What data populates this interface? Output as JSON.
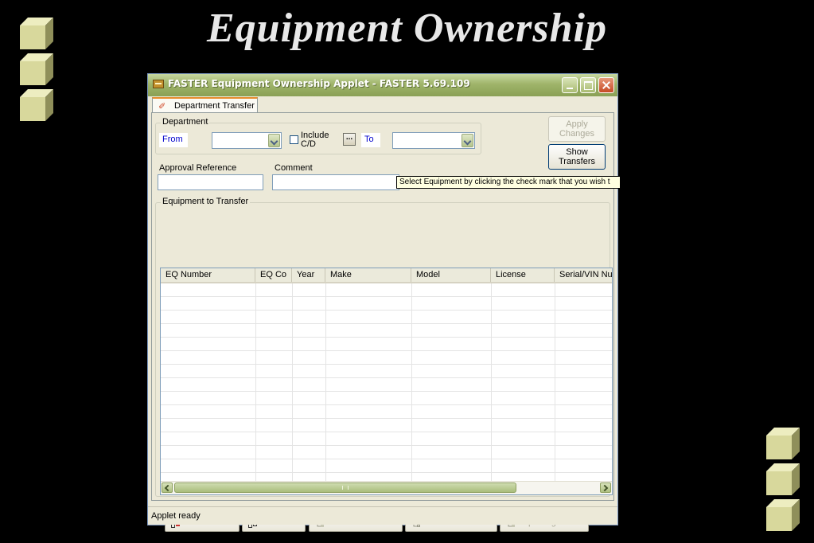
{
  "slide": {
    "title": "Equipment Ownership"
  },
  "window": {
    "title": "FASTER Equipment Ownership Applet - FASTER 5.69.109"
  },
  "tab": {
    "label": "Department Transfer"
  },
  "department": {
    "legend": "Department",
    "from_label": "From",
    "from_value": "",
    "include_cd_label": "Include C/D",
    "include_cd_checked": false,
    "browse_label": "...",
    "to_label": "To",
    "to_value": ""
  },
  "buttons": {
    "apply": "Apply Changes",
    "show": "Show Transfers"
  },
  "approval": {
    "label": "Approval Reference",
    "value": ""
  },
  "comment": {
    "label": "Comment",
    "value": ""
  },
  "tooltip": "Select Equipment by clicking the check mark that you wish t",
  "grid": {
    "legend": "Equipment to Transfer",
    "columns": [
      "EQ Number",
      "EQ Co",
      "Year",
      "Make",
      "Model",
      "License",
      "Serial/VIN Nur"
    ],
    "rows": []
  },
  "toolbar": {
    "select_all": "Select All",
    "clear_all": "Clear All",
    "select_children": "Select Children",
    "clear_children": "Clear Children",
    "eq_range": "Eq. Range ..."
  },
  "status": "Applet ready",
  "colors": {
    "cube": "#c7c78a",
    "title_bar": "#9fb46a",
    "accent_tab": "#e68b2c"
  }
}
